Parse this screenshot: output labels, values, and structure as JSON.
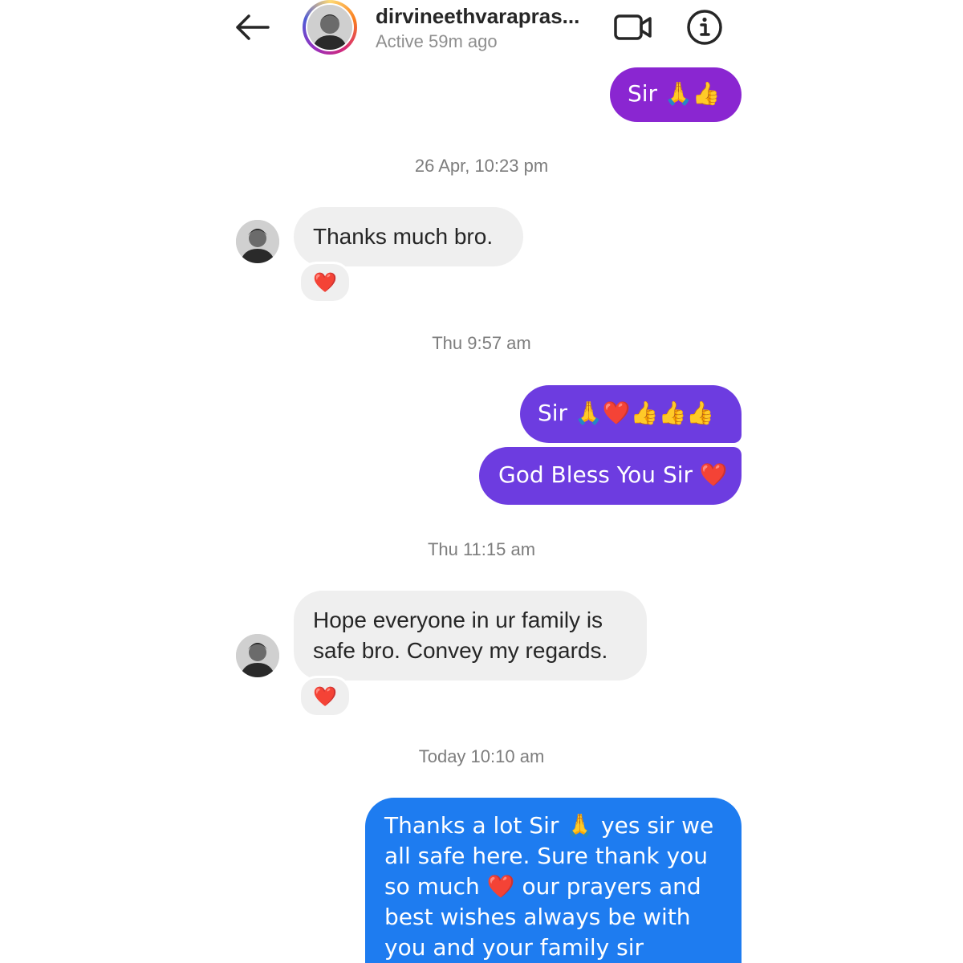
{
  "header": {
    "username": "dirvineethvarapras...",
    "status": "Active 59m ago"
  },
  "icons": {
    "back": "arrow-left-icon",
    "video": "video-camera-icon",
    "info": "info-icon",
    "heart": "heart-icon"
  },
  "colors": {
    "bubble_purple": "#8a26d1",
    "bubble_violet": "#6d3ce0",
    "bubble_blue": "#1e7cf0",
    "bubble_incoming": "#efefef",
    "heart": "#e0242e"
  },
  "messages": [
    {
      "direction": "out",
      "text": "Sir 🙏👍"
    },
    {
      "direction": "timestamp",
      "text": "26 Apr, 10:23 pm"
    },
    {
      "direction": "in",
      "text": "Thanks much bro.",
      "reaction": "❤️"
    },
    {
      "direction": "timestamp",
      "text": "Thu 9:57 am"
    },
    {
      "direction": "out",
      "text": "Sir 🙏❤️👍👍👍"
    },
    {
      "direction": "out",
      "text": "God Bless You Sir ❤️"
    },
    {
      "direction": "timestamp",
      "text": "Thu 11:15 am"
    },
    {
      "direction": "in",
      "text": "Hope everyone in ur family is safe bro. Convey my regards.",
      "reaction": "❤️"
    },
    {
      "direction": "timestamp",
      "text": "Today 10:10 am"
    },
    {
      "direction": "out",
      "text": "Thanks a lot Sir 🙏 yes sir we all safe here. Sure thank you so much ❤️ our prayers and best wishes always be with you and your family sir"
    }
  ]
}
